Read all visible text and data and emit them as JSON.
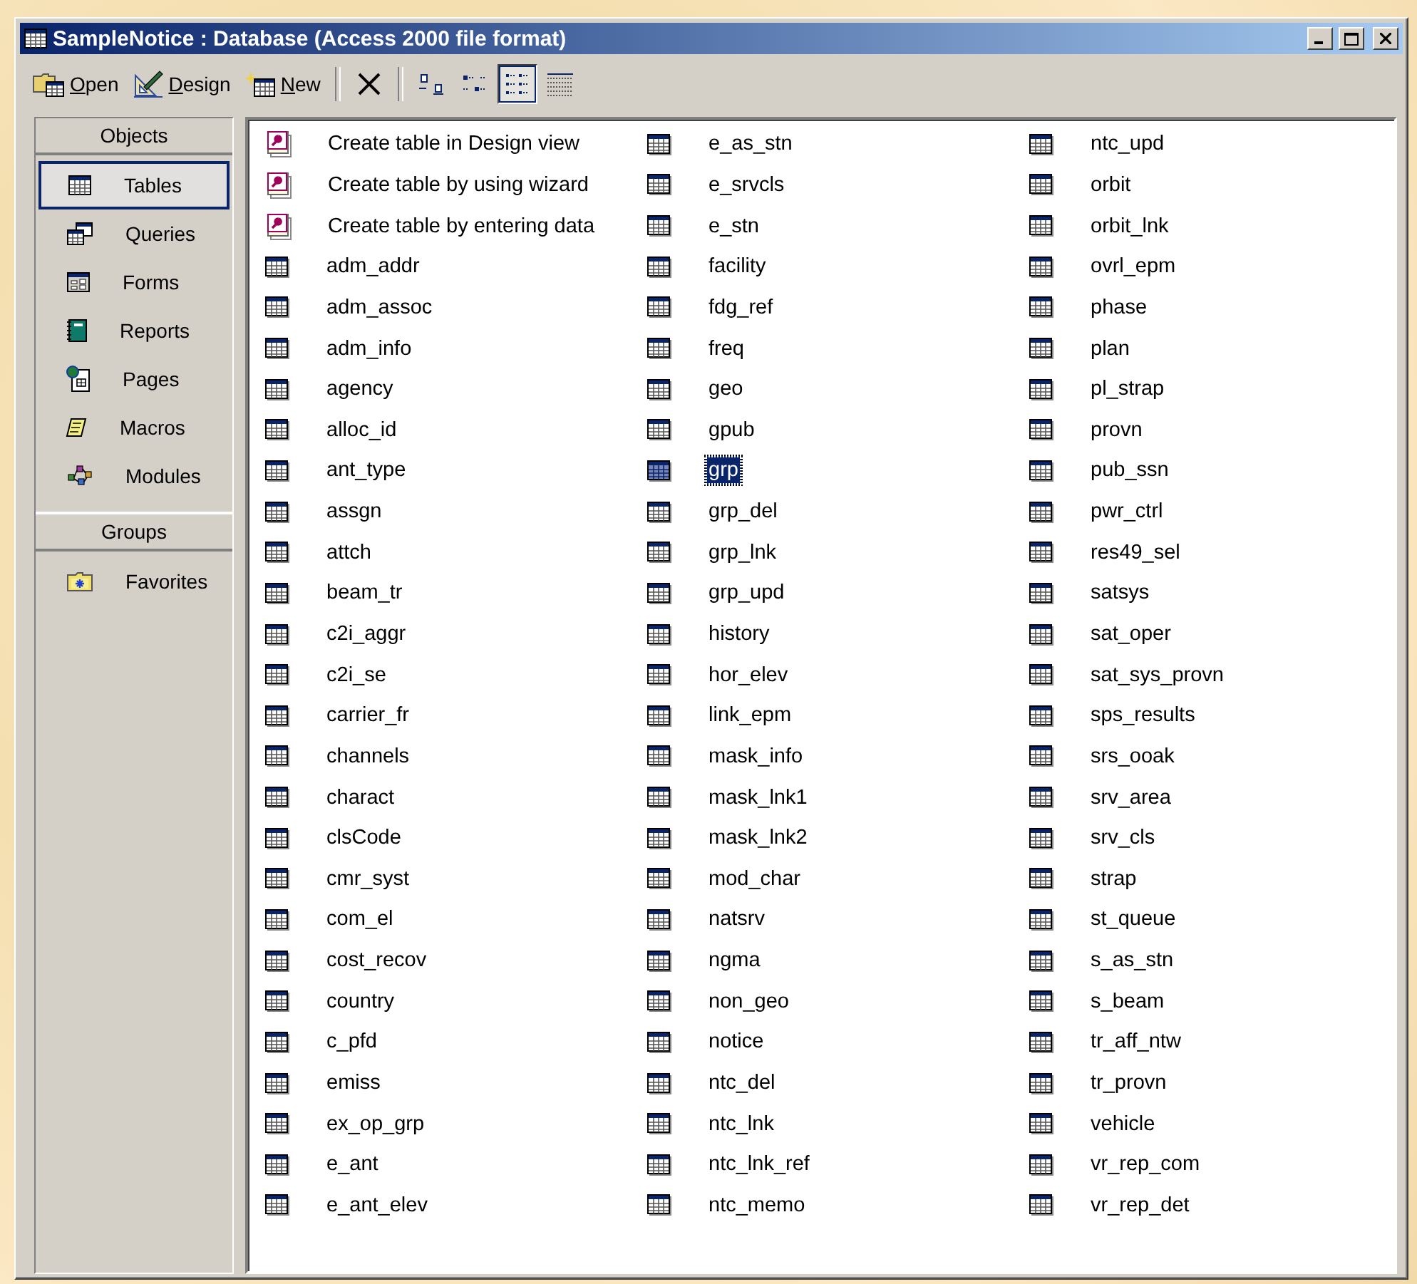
{
  "window": {
    "title": "SampleNotice : Database (Access 2000 file format)"
  },
  "toolbar": [
    {
      "kind": "open",
      "label": "Open"
    },
    {
      "kind": "design",
      "label": "Design"
    },
    {
      "kind": "new",
      "label": "New"
    },
    {
      "kind": "delete",
      "pressed": false
    },
    {
      "kind": "large_icons",
      "pressed": false
    },
    {
      "kind": "small_icons",
      "pressed": false
    },
    {
      "kind": "list",
      "pressed": true
    },
    {
      "kind": "details",
      "pressed": false
    }
  ],
  "sidebar": {
    "sections": [
      {
        "header": "Objects",
        "items": [
          {
            "kind": "tables",
            "label": "Tables",
            "selected": true
          },
          {
            "kind": "queries",
            "label": "Queries",
            "selected": false
          },
          {
            "kind": "forms",
            "label": "Forms",
            "selected": false
          },
          {
            "kind": "reports",
            "label": "Reports",
            "selected": false
          },
          {
            "kind": "pages",
            "label": "Pages",
            "selected": false
          },
          {
            "kind": "macros",
            "label": "Macros",
            "selected": false
          },
          {
            "kind": "modules",
            "label": "Modules",
            "selected": false
          }
        ]
      },
      {
        "header": "Groups",
        "items": [
          {
            "kind": "favorites",
            "label": "Favorites",
            "selected": false
          }
        ]
      }
    ]
  },
  "items": [
    {
      "kind": "shortcut",
      "label": "Create table in Design view",
      "selected": false
    },
    {
      "kind": "shortcut",
      "label": "Create table by using wizard",
      "selected": false
    },
    {
      "kind": "shortcut",
      "label": "Create table by entering data",
      "selected": false
    },
    {
      "kind": "table",
      "label": "adm_addr",
      "selected": false
    },
    {
      "kind": "table",
      "label": "adm_assoc",
      "selected": false
    },
    {
      "kind": "table",
      "label": "adm_info",
      "selected": false
    },
    {
      "kind": "table",
      "label": "agency",
      "selected": false
    },
    {
      "kind": "table",
      "label": "alloc_id",
      "selected": false
    },
    {
      "kind": "table",
      "label": "ant_type",
      "selected": false
    },
    {
      "kind": "table",
      "label": "assgn",
      "selected": false
    },
    {
      "kind": "table",
      "label": "attch",
      "selected": false
    },
    {
      "kind": "table",
      "label": "beam_tr",
      "selected": false
    },
    {
      "kind": "table",
      "label": "c2i_aggr",
      "selected": false
    },
    {
      "kind": "table",
      "label": "c2i_se",
      "selected": false
    },
    {
      "kind": "table",
      "label": "carrier_fr",
      "selected": false
    },
    {
      "kind": "table",
      "label": "channels",
      "selected": false
    },
    {
      "kind": "table",
      "label": "charact",
      "selected": false
    },
    {
      "kind": "table",
      "label": "clsCode",
      "selected": false
    },
    {
      "kind": "table",
      "label": "cmr_syst",
      "selected": false
    },
    {
      "kind": "table",
      "label": "com_el",
      "selected": false
    },
    {
      "kind": "table",
      "label": "cost_recov",
      "selected": false
    },
    {
      "kind": "table",
      "label": "country",
      "selected": false
    },
    {
      "kind": "table",
      "label": "c_pfd",
      "selected": false
    },
    {
      "kind": "table",
      "label": "emiss",
      "selected": false
    },
    {
      "kind": "table",
      "label": "ex_op_grp",
      "selected": false
    },
    {
      "kind": "table",
      "label": "e_ant",
      "selected": false
    },
    {
      "kind": "table",
      "label": "e_ant_elev",
      "selected": false
    },
    {
      "kind": "table",
      "label": "e_as_stn",
      "selected": false
    },
    {
      "kind": "table",
      "label": "e_srvcls",
      "selected": false
    },
    {
      "kind": "table",
      "label": "e_stn",
      "selected": false
    },
    {
      "kind": "table",
      "label": "facility",
      "selected": false
    },
    {
      "kind": "table",
      "label": "fdg_ref",
      "selected": false
    },
    {
      "kind": "table",
      "label": "freq",
      "selected": false
    },
    {
      "kind": "table",
      "label": "geo",
      "selected": false
    },
    {
      "kind": "table",
      "label": "gpub",
      "selected": false
    },
    {
      "kind": "table",
      "label": "grp",
      "selected": true
    },
    {
      "kind": "table",
      "label": "grp_del",
      "selected": false
    },
    {
      "kind": "table",
      "label": "grp_lnk",
      "selected": false
    },
    {
      "kind": "table",
      "label": "grp_upd",
      "selected": false
    },
    {
      "kind": "table",
      "label": "history",
      "selected": false
    },
    {
      "kind": "table",
      "label": "hor_elev",
      "selected": false
    },
    {
      "kind": "table",
      "label": "link_epm",
      "selected": false
    },
    {
      "kind": "table",
      "label": "mask_info",
      "selected": false
    },
    {
      "kind": "table",
      "label": "mask_lnk1",
      "selected": false
    },
    {
      "kind": "table",
      "label": "mask_lnk2",
      "selected": false
    },
    {
      "kind": "table",
      "label": "mod_char",
      "selected": false
    },
    {
      "kind": "table",
      "label": "natsrv",
      "selected": false
    },
    {
      "kind": "table",
      "label": "ngma",
      "selected": false
    },
    {
      "kind": "table",
      "label": "non_geo",
      "selected": false
    },
    {
      "kind": "table",
      "label": "notice",
      "selected": false
    },
    {
      "kind": "table",
      "label": "ntc_del",
      "selected": false
    },
    {
      "kind": "table",
      "label": "ntc_lnk",
      "selected": false
    },
    {
      "kind": "table",
      "label": "ntc_lnk_ref",
      "selected": false
    },
    {
      "kind": "table",
      "label": "ntc_memo",
      "selected": false
    },
    {
      "kind": "table",
      "label": "ntc_upd",
      "selected": false
    },
    {
      "kind": "table",
      "label": "orbit",
      "selected": false
    },
    {
      "kind": "table",
      "label": "orbit_lnk",
      "selected": false
    },
    {
      "kind": "table",
      "label": "ovrl_epm",
      "selected": false
    },
    {
      "kind": "table",
      "label": "phase",
      "selected": false
    },
    {
      "kind": "table",
      "label": "plan",
      "selected": false
    },
    {
      "kind": "table",
      "label": "pl_strap",
      "selected": false
    },
    {
      "kind": "table",
      "label": "provn",
      "selected": false
    },
    {
      "kind": "table",
      "label": "pub_ssn",
      "selected": false
    },
    {
      "kind": "table",
      "label": "pwr_ctrl",
      "selected": false
    },
    {
      "kind": "table",
      "label": "res49_sel",
      "selected": false
    },
    {
      "kind": "table",
      "label": "satsys",
      "selected": false
    },
    {
      "kind": "table",
      "label": "sat_oper",
      "selected": false
    },
    {
      "kind": "table",
      "label": "sat_sys_provn",
      "selected": false
    },
    {
      "kind": "table",
      "label": "sps_results",
      "selected": false
    },
    {
      "kind": "table",
      "label": "srs_ooak",
      "selected": false
    },
    {
      "kind": "table",
      "label": "srv_area",
      "selected": false
    },
    {
      "kind": "table",
      "label": "srv_cls",
      "selected": false
    },
    {
      "kind": "table",
      "label": "strap",
      "selected": false
    },
    {
      "kind": "table",
      "label": "st_queue",
      "selected": false
    },
    {
      "kind": "table",
      "label": "s_as_stn",
      "selected": false
    },
    {
      "kind": "table",
      "label": "s_beam",
      "selected": false
    },
    {
      "kind": "table",
      "label": "tr_aff_ntw",
      "selected": false
    },
    {
      "kind": "table",
      "label": "tr_provn",
      "selected": false
    },
    {
      "kind": "table",
      "label": "vehicle",
      "selected": false
    },
    {
      "kind": "table",
      "label": "vr_rep_com",
      "selected": false
    },
    {
      "kind": "table",
      "label": "vr_rep_det",
      "selected": false
    }
  ]
}
